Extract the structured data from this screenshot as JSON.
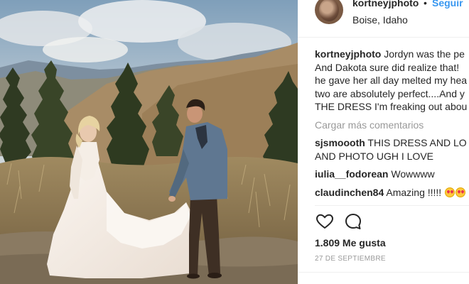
{
  "post": {
    "photo_alt": "",
    "header": {
      "username": "kortneyjphoto",
      "separator": "•",
      "follow_label": "Seguir",
      "location": "Boise, Idaho"
    },
    "caption": {
      "username": "kortneyjphoto",
      "lines": [
        "Jordyn was the pe",
        "And Dakota sure did realize that!",
        "he gave her all day melted my hea",
        "two are absolutely perfect....And y",
        "THE DRESS I'm freaking out abou"
      ]
    },
    "load_more_label": "Cargar más comentarios",
    "comments": [
      {
        "username": "sjsmoooth",
        "text": "THIS DRESS AND LO",
        "text2": "AND PHOTO UGH I LOVE"
      },
      {
        "username": "iulia__fodorean",
        "text": "Wowwww"
      },
      {
        "username": "claudinchen84",
        "text": "Amazing !!!!!",
        "emoji_count": 2,
        "emoji": "heart-eyes-emoji"
      }
    ],
    "actions": {
      "like_icon": "heart-icon",
      "comment_icon": "comment-bubble-icon"
    },
    "likes_label": "1.809 Me gusta",
    "date_label": "27 DE SEPTIEMBRE",
    "colors": {
      "link_blue": "#3897f0",
      "text": "#262626",
      "muted": "#999999",
      "divider": "#efefef"
    }
  }
}
